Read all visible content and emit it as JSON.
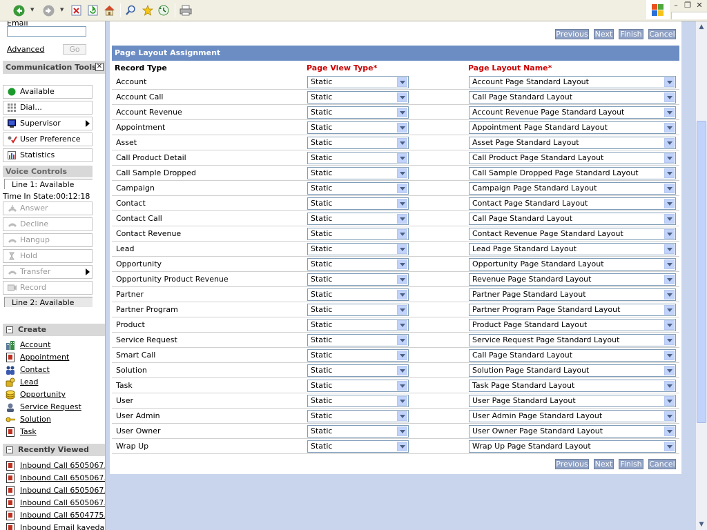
{
  "toolbar": {
    "icons": [
      "back-icon",
      "forward-icon",
      "stop-icon",
      "refresh-icon",
      "home-icon",
      "search-icon",
      "favorites-icon",
      "history-icon",
      "print-icon"
    ]
  },
  "left": {
    "email_label": "Email",
    "advanced_link": "Advanced",
    "go_button": "Go",
    "comm_tools_title": "Communication Tools",
    "comm_buttons": {
      "available": "Available",
      "dial": "Dial...",
      "supervisor": "Supervisor",
      "user_preference": "User Preference",
      "statistics": "Statistics"
    },
    "voice_controls_title": "Voice Controls",
    "line1": "Line 1: Available",
    "time_in_state": "Time In State:00:12:18",
    "voice_buttons": {
      "answer": "Answer",
      "decline": "Decline",
      "hangup": "Hangup",
      "hold": "Hold",
      "transfer": "Transfer",
      "record": "Record"
    },
    "line2": "Line 2: Available",
    "create_title": "Create",
    "create_items": [
      "Account",
      "Appointment",
      "Contact",
      "Lead",
      "Opportunity",
      "Service Request",
      "Solution",
      "Task"
    ],
    "recent_title": "Recently Viewed",
    "recent_items": [
      "Inbound Call 6505067…",
      "Inbound Call 6505067…",
      "Inbound Call 6505067…",
      "Inbound Call 6505067…",
      "Inbound Call 6504775…",
      "Inbound Email kayeda…"
    ]
  },
  "main": {
    "buttons": {
      "previous": "Previous",
      "next": "Next",
      "finish": "Finish",
      "cancel": "Cancel"
    },
    "panel_title": "Page Layout Assignment",
    "columns": {
      "record_type": "Record Type",
      "page_view_type": "Page View Type*",
      "page_layout_name": "Page Layout Name*"
    },
    "rows": [
      {
        "record_type": "Account",
        "view_type": "Static",
        "layout": "Account Page Standard Layout"
      },
      {
        "record_type": "Account Call",
        "view_type": "Static",
        "layout": "Call Page Standard Layout"
      },
      {
        "record_type": "Account Revenue",
        "view_type": "Static",
        "layout": "Account Revenue Page Standard Layout"
      },
      {
        "record_type": "Appointment",
        "view_type": "Static",
        "layout": "Appointment Page Standard Layout"
      },
      {
        "record_type": "Asset",
        "view_type": "Static",
        "layout": "Asset Page Standard Layout"
      },
      {
        "record_type": "Call Product Detail",
        "view_type": "Static",
        "layout": "Call Product Page Standard Layout"
      },
      {
        "record_type": "Call Sample Dropped",
        "view_type": "Static",
        "layout": "Call Sample Dropped Page Standard Layout"
      },
      {
        "record_type": "Campaign",
        "view_type": "Static",
        "layout": "Campaign Page Standard Layout"
      },
      {
        "record_type": "Contact",
        "view_type": "Static",
        "layout": "Contact Page Standard Layout"
      },
      {
        "record_type": "Contact Call",
        "view_type": "Static",
        "layout": "Call Page Standard Layout"
      },
      {
        "record_type": "Contact Revenue",
        "view_type": "Static",
        "layout": "Contact Revenue Page Standard Layout"
      },
      {
        "record_type": "Lead",
        "view_type": "Static",
        "layout": "Lead Page Standard Layout"
      },
      {
        "record_type": "Opportunity",
        "view_type": "Static",
        "layout": "Opportunity Page Standard Layout"
      },
      {
        "record_type": "Opportunity Product Revenue",
        "view_type": "Static",
        "layout": "Revenue Page Standard Layout"
      },
      {
        "record_type": "Partner",
        "view_type": "Static",
        "layout": "Partner Page Standard Layout"
      },
      {
        "record_type": "Partner Program",
        "view_type": "Static",
        "layout": "Partner Program Page Standard Layout"
      },
      {
        "record_type": "Product",
        "view_type": "Static",
        "layout": "Product Page Standard Layout"
      },
      {
        "record_type": "Service Request",
        "view_type": "Static",
        "layout": "Service Request Page Standard Layout"
      },
      {
        "record_type": "Smart Call",
        "view_type": "Static",
        "layout": "Call Page Standard Layout"
      },
      {
        "record_type": "Solution",
        "view_type": "Static",
        "layout": "Solution Page Standard Layout"
      },
      {
        "record_type": "Task",
        "view_type": "Static",
        "layout": "Task Page Standard Layout"
      },
      {
        "record_type": "User",
        "view_type": "Static",
        "layout": "User Page Standard Layout"
      },
      {
        "record_type": "User Admin",
        "view_type": "Static",
        "layout": "User Admin Page Standard Layout"
      },
      {
        "record_type": "User Owner",
        "view_type": "Static",
        "layout": "User Owner Page Standard Layout"
      },
      {
        "record_type": "Wrap Up",
        "view_type": "Static",
        "layout": "Wrap Up Page Standard Layout"
      }
    ]
  },
  "colors": {
    "panel_header": "#6b8dc4",
    "nav_button": "#8fa1c4",
    "required": "#cc0000",
    "available_dot": "#1a9a2a"
  }
}
